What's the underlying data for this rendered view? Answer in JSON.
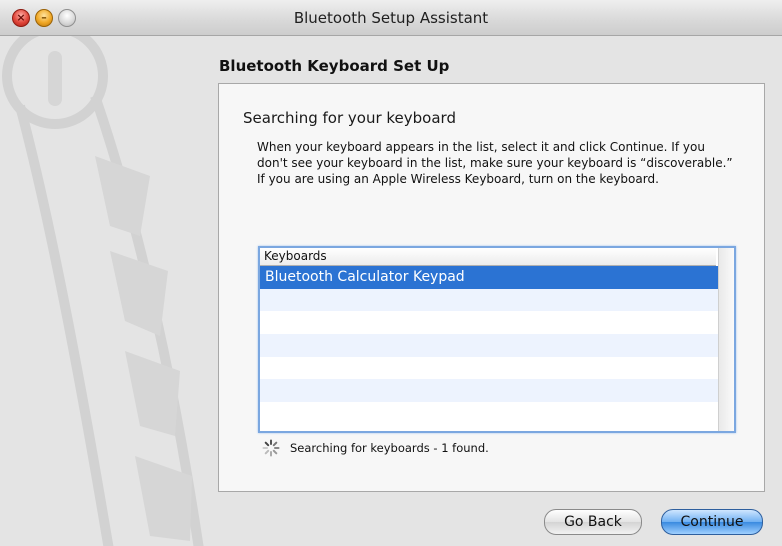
{
  "window": {
    "title": "Bluetooth Setup Assistant",
    "traffic_lights": [
      "close-icon",
      "minimize-icon",
      "zoom-icon"
    ]
  },
  "page": {
    "heading": "Bluetooth Keyboard Set Up",
    "subtitle": "Searching for your keyboard",
    "description": "When your keyboard appears in the list, select it and click Continue. If you don't see your keyboard in the list, make sure your keyboard is “discoverable.”  If you are using an Apple Wireless Keyboard, turn on the keyboard."
  },
  "list": {
    "column_header": "Keyboards",
    "items": [
      "Bluetooth Calculator Keypad"
    ],
    "selected_index": 0,
    "empty_rows": 6
  },
  "status": {
    "text": "Searching for keyboards - 1 found.",
    "icon": "progress-spinner-icon"
  },
  "buttons": {
    "back_label": "Go Back",
    "continue_label": "Continue"
  },
  "colors": {
    "selection": "#2b73d3",
    "list_focus": "#7ba7e0",
    "alt_row": "#edf3fe"
  }
}
